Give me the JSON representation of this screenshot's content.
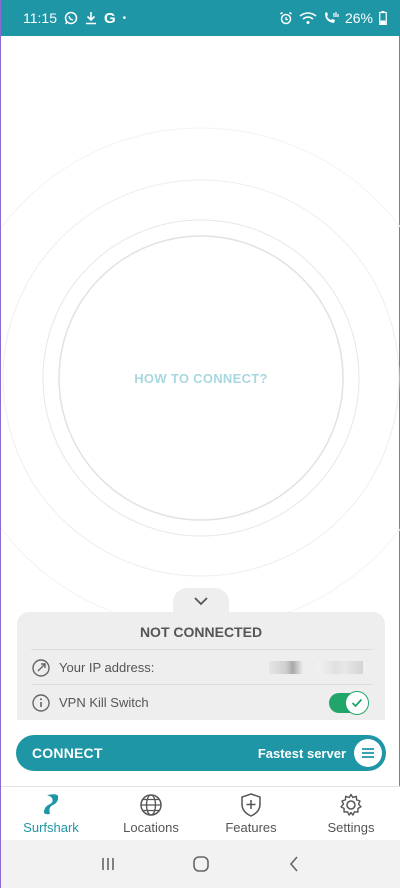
{
  "status_bar": {
    "time": "11:15",
    "g_letter": "G",
    "dot": "•",
    "battery": "26%",
    "icons": [
      "whatsapp-icon",
      "download-icon",
      "google-icon",
      "alarm-icon",
      "wifi-call-icon",
      "call-icon",
      "battery-icon"
    ]
  },
  "main": {
    "how_to_connect": "HOW TO CONNECT?"
  },
  "panel": {
    "title": "NOT CONNECTED",
    "ip_label": "Your IP address:",
    "kill_switch_label": "VPN Kill Switch",
    "kill_switch_on": true
  },
  "connect": {
    "label": "CONNECT",
    "server": "Fastest server"
  },
  "nav": {
    "items": [
      {
        "label": "Surfshark",
        "icon": "surfshark-logo-icon",
        "active": true
      },
      {
        "label": "Locations",
        "icon": "globe-icon",
        "active": false
      },
      {
        "label": "Features",
        "icon": "shield-plus-icon",
        "active": false
      },
      {
        "label": "Settings",
        "icon": "gear-icon",
        "active": false
      }
    ]
  },
  "colors": {
    "brand": "#1f96a6",
    "toggle_on": "#21a56a",
    "hint_text": "#a9d7e0"
  }
}
